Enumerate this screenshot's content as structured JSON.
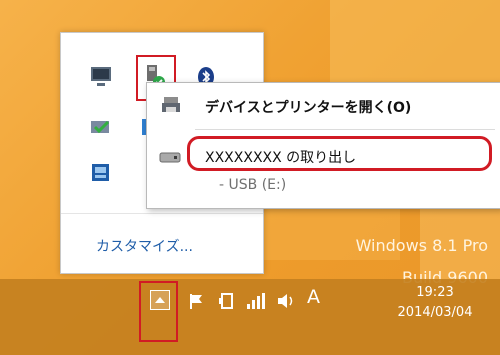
{
  "desktop": {
    "watermark_line1": "Windows 8.1 Pro",
    "watermark_line2": "Build 9600"
  },
  "tray_popup": {
    "customize_link": "カスタマイズ..."
  },
  "context_menu": {
    "open_devices": "デバイスとプリンターを開く(O)",
    "eject": "XXXXXXXX の取り出し",
    "drive": "-   USB (E:)"
  },
  "taskbar": {
    "ime_indicator": "A",
    "time": "19:23",
    "date": "2014/03/04"
  },
  "colors": {
    "highlight_red": "#d11b24",
    "link_blue": "#1f5da8",
    "taskbar": "#c48020",
    "desktop": "#f0a233"
  },
  "icons": [
    "monitor-icon",
    "usb-safely-remove-icon",
    "bluetooth-icon",
    "action-center-icon",
    "display-icon",
    "printer-icon",
    "drive-icon",
    "overflow-chevron-icon",
    "flag-icon",
    "tablet-icon",
    "network-icon",
    "volume-icon"
  ]
}
